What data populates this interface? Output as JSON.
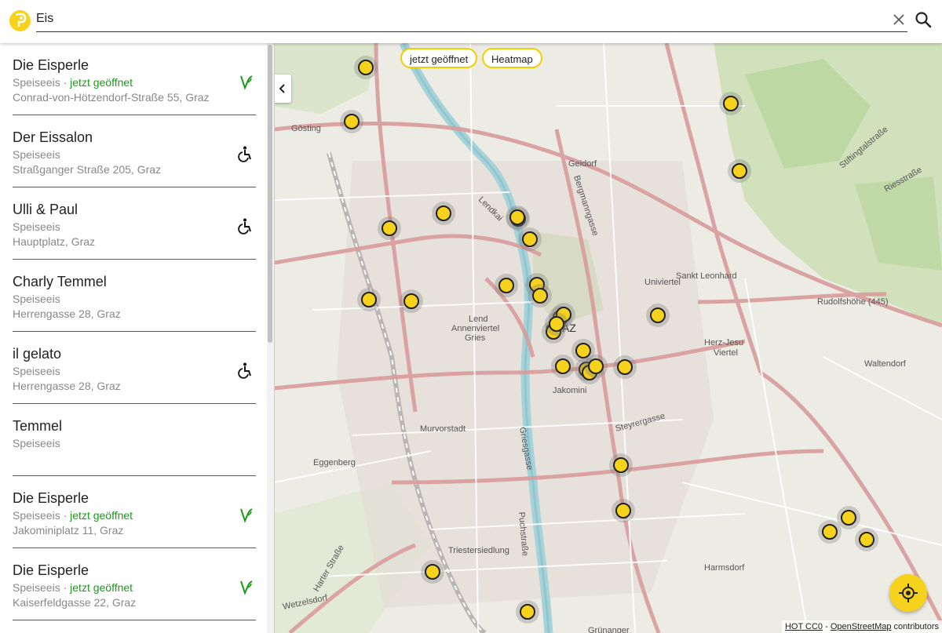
{
  "search": {
    "value": "Eis",
    "clear_icon": "close-icon",
    "search_icon": "search-icon"
  },
  "results": [
    {
      "name": "Die Eisperle",
      "category": "Speiseeis",
      "status": "jetzt geöffnet",
      "address": "Conrad-von-Hötzendorf-Straße 55, Graz",
      "badge": "vegan-icon"
    },
    {
      "name": "Der Eissalon",
      "category": "Speiseeis",
      "status": "",
      "address": "Straßganger Straße 205, Graz",
      "badge": "wheelchair-icon"
    },
    {
      "name": "Ulli & Paul",
      "category": "Speiseeis",
      "status": "",
      "address": "Hauptplatz, Graz",
      "badge": "wheelchair-icon"
    },
    {
      "name": "Charly Temmel",
      "category": "Speiseeis",
      "status": "",
      "address": "Herrengasse 28, Graz",
      "badge": ""
    },
    {
      "name": "il gelato",
      "category": "Speiseeis",
      "status": "",
      "address": "Herrengasse 28, Graz",
      "badge": "wheelchair-icon"
    },
    {
      "name": "Temmel",
      "category": "Speiseeis",
      "status": "",
      "address": "",
      "badge": ""
    },
    {
      "name": "Die Eisperle",
      "category": "Speiseeis",
      "status": "jetzt geöffnet",
      "address": "Jakominiplatz 11, Graz",
      "badge": "vegan-icon"
    },
    {
      "name": "Die Eisperle",
      "category": "Speiseeis",
      "status": "jetzt geöffnet",
      "address": "Kaiserfeldgasse 22, Graz",
      "badge": "vegan-icon"
    }
  ],
  "status_separator": " · ",
  "map": {
    "filters": {
      "open_now": "jetzt geöffnet",
      "heatmap": "Heatmap"
    },
    "labels": {
      "graz": "GRAZ",
      "geidorf": "Geidorf",
      "lend": "Lend",
      "gries": "Gries",
      "jakomini": "Jakomini",
      "annenviertel": "Annenviertel",
      "eggenberg": "Eggenberg",
      "gosting": "Gösting",
      "murvorstadt": "Murvorstadt",
      "waltendorf": "Waltendorf",
      "harmsdorf": "Harmsdorf",
      "rudolfshoehe": "Rudolfshöhe (445)",
      "herz_jesu": "Herz-Jesu",
      "viertel": "Viertel",
      "univiertel": "Univiertel",
      "sankt_leonhard": "Sankt Leonhard",
      "triester": "Triestersiedlung",
      "gruenanger": "Grünanger",
      "bergmanngasse": "Bergmanngasse",
      "griesgasse": "Griesgasse",
      "steyrergasse": "Steyrergasse",
      "puchstrasse": "Puchstraße",
      "lendkai": "Lendkai",
      "riesstrasse": "Riesstraße",
      "stiftingtalstrasse": "Stiftingtalstraße",
      "wetzelsdorf": "Wetzelsdorf",
      "harter_strasse": "Harter Straße"
    },
    "attribution": {
      "hot": "HOT CC0",
      "sep": " - ",
      "osm": "OpenStreetMap",
      "tail": " contributors"
    },
    "locate_icon": "crosshair-icon",
    "collapse_icon": "chevron-left-icon"
  }
}
